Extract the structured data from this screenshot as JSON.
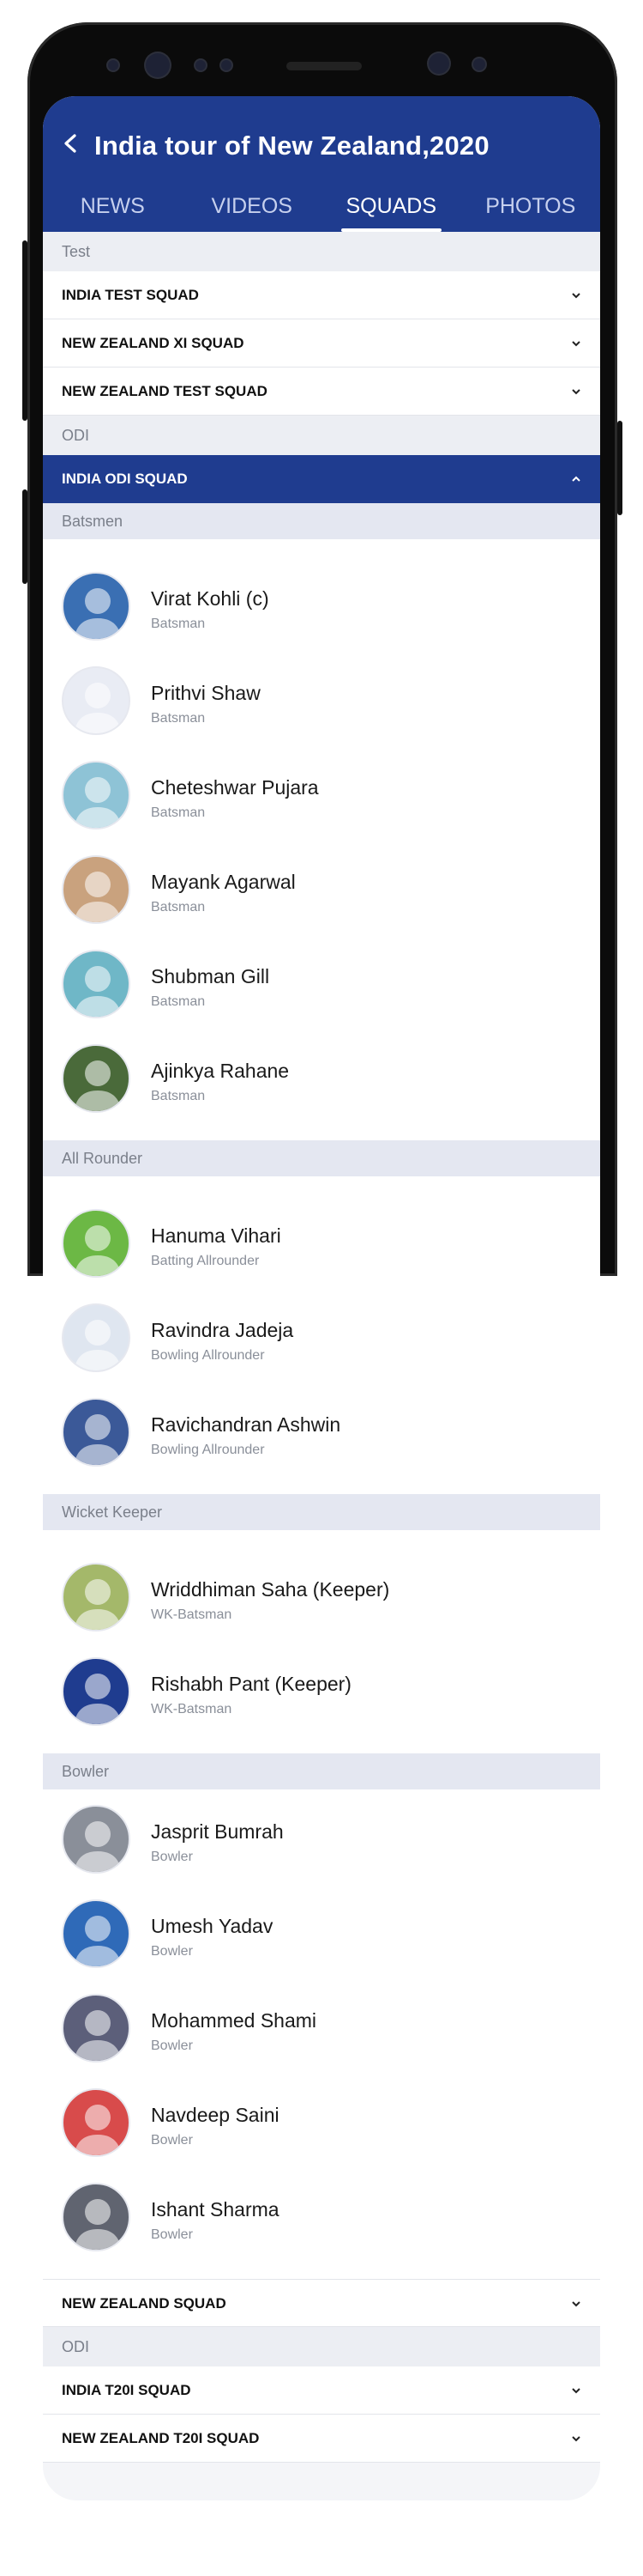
{
  "header": {
    "title": "India tour of New Zealand,2020",
    "tabs": [
      "NEWS",
      "VIDEOS",
      "SQUADS",
      "PHOTOS"
    ],
    "active_tab": "SQUADS",
    "bg_color": "#1f3c8f"
  },
  "sections": {
    "test": "Test",
    "odi": "ODI",
    "odi2": "ODI",
    "batsmen": "Batsmen",
    "all_rounder": "All Rounder",
    "wicket_keeper": "Wicket Keeper",
    "bowler": "Bowler"
  },
  "accordions": {
    "india_test": "INDIA TEST SQUAD",
    "nz_xi": "NEW ZEALAND XI SQUAD",
    "nz_test": "NEW ZEALAND TEST SQUAD",
    "india_odi": "INDIA ODI SQUAD",
    "nz_squad": "NEW ZEALAND SQUAD",
    "india_t20": "INDIA T20I SQUAD",
    "nz_t20": "NEW ZEALAND T20I SQUAD"
  },
  "batsmen": [
    {
      "name": "Virat Kohli (c)",
      "role": "Batsman"
    },
    {
      "name": "Prithvi Shaw",
      "role": "Batsman"
    },
    {
      "name": "Cheteshwar Pujara",
      "role": "Batsman"
    },
    {
      "name": "Mayank Agarwal",
      "role": "Batsman"
    },
    {
      "name": "Shubman Gill",
      "role": "Batsman"
    },
    {
      "name": "Ajinkya Rahane",
      "role": "Batsman"
    }
  ],
  "all_rounders": [
    {
      "name": "Hanuma Vihari",
      "role": "Batting Allrounder"
    },
    {
      "name": "Ravindra Jadeja",
      "role": "Bowling  Allrounder"
    },
    {
      "name": "Ravichandran Ashwin",
      "role": "Bowling  Allrounder"
    }
  ],
  "keepers": [
    {
      "name": "Wriddhiman Saha (Keeper)",
      "role": "WK-Batsman"
    },
    {
      "name": "Rishabh Pant (Keeper)",
      "role": "WK-Batsman"
    }
  ],
  "bowlers": [
    {
      "name": "Jasprit Bumrah",
      "role": "Bowler"
    },
    {
      "name": "Umesh Yadav",
      "role": "Bowler"
    },
    {
      "name": "Mohammed Shami",
      "role": "Bowler"
    },
    {
      "name": "Navdeep Saini",
      "role": "Bowler"
    },
    {
      "name": "Ishant Sharma",
      "role": "Bowler"
    }
  ]
}
